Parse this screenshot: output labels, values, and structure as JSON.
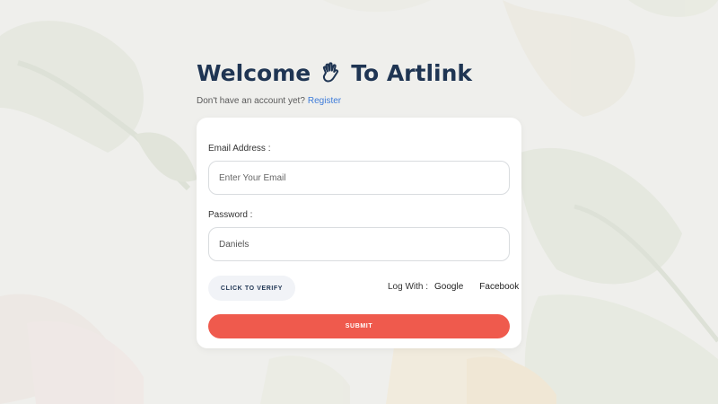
{
  "header": {
    "title_prefix": "Welcome",
    "title_suffix": "To Artlink",
    "subtitle_text": "Don't have an account yet?",
    "register_link": "Register"
  },
  "form": {
    "email_label": "Email Address :",
    "email_placeholder": "Enter Your Email",
    "password_label": "Password :",
    "password_value": "Daniels",
    "verify_button": "CLICK TO VERIFY",
    "log_with_label": "Log With :",
    "providers": [
      "Google",
      "Facebook"
    ],
    "submit_button": "SUBMIT"
  },
  "colors": {
    "title": "#1f3553",
    "link": "#3d7bd9",
    "submit": "#ef5a4d",
    "background": "#efefec"
  },
  "icons": {
    "title_icon": "waving-hand-icon"
  }
}
